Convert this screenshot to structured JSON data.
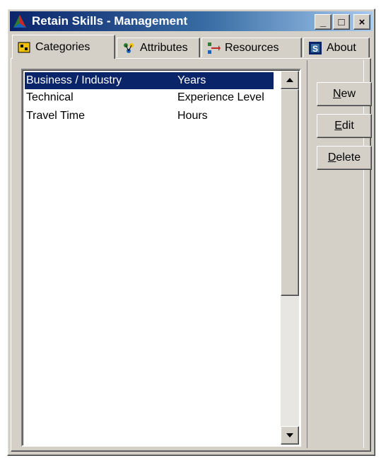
{
  "window": {
    "title": "Retain Skills - Management"
  },
  "titlebar_buttons": {
    "minimize": "_",
    "maximize": "□",
    "close": "×"
  },
  "tabs": [
    {
      "label": "Categories",
      "icon": "categories-icon",
      "active": true
    },
    {
      "label": "Attributes",
      "icon": "attributes-icon",
      "active": false
    },
    {
      "label": "Resources",
      "icon": "resources-icon",
      "active": false
    },
    {
      "label": "About",
      "icon": "about-icon",
      "active": false
    }
  ],
  "list": {
    "rows": [
      {
        "name": "Business / Industry",
        "unit": "Years",
        "selected": true
      },
      {
        "name": "Technical",
        "unit": "Experience Level",
        "selected": false
      },
      {
        "name": "Travel Time",
        "unit": "Hours",
        "selected": false
      }
    ]
  },
  "buttons": {
    "new": {
      "accel": "N",
      "rest": "ew"
    },
    "edit": {
      "accel": "E",
      "rest": "dit"
    },
    "delete": {
      "accel": "D",
      "rest": "elete"
    }
  },
  "colors": {
    "selection": "#0a246a",
    "face": "#d4d0c8"
  }
}
